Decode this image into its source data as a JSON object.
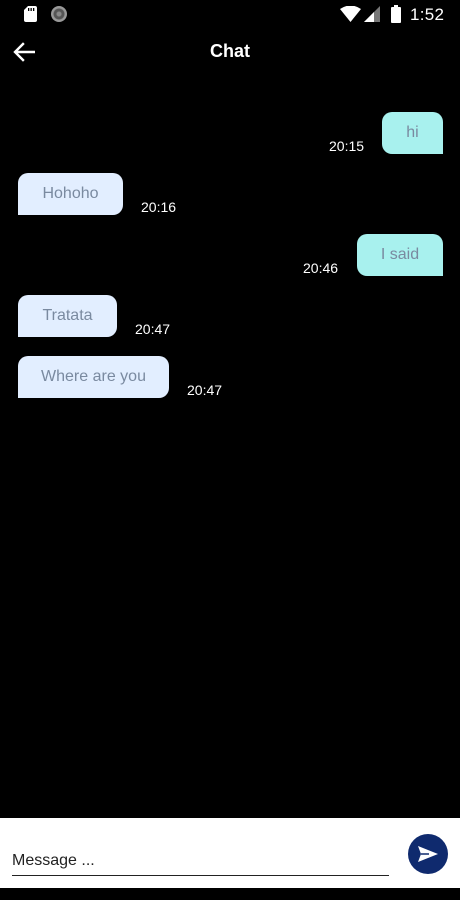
{
  "status_bar": {
    "time": "1:52",
    "icons": [
      "sd-card-icon",
      "record-icon",
      "wifi-icon",
      "signal-icon",
      "battery-icon"
    ]
  },
  "header": {
    "title": "Chat",
    "back_icon": "arrow-left-icon"
  },
  "messages": [
    {
      "text": "hi",
      "time": "20:15",
      "direction": "out"
    },
    {
      "text": "Hohoho",
      "time": "20:16",
      "direction": "in"
    },
    {
      "text": "I said",
      "time": "20:46",
      "direction": "out"
    },
    {
      "text": "Tratata",
      "time": "20:47",
      "direction": "in"
    },
    {
      "text": "Where are you",
      "time": "20:47",
      "direction": "in"
    }
  ],
  "composer": {
    "placeholder": "Message ...",
    "value": "",
    "send_icon": "send-icon"
  },
  "colors": {
    "background": "#000000",
    "outgoing_bubble": "#a8f1ee",
    "incoming_bubble": "#e2eeff",
    "bubble_text": "#7a8aa0",
    "send_button": "#0f2a6e"
  }
}
